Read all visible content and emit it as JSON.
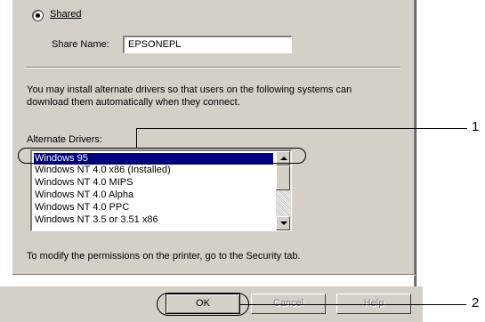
{
  "sharing": {
    "shared_label": "Shared",
    "shared_selected": true,
    "share_name_label": "Share Name:",
    "share_name_value": "EPSONEPL"
  },
  "drivers": {
    "description_line1": "You may install alternate drivers so that users on the following systems can",
    "description_line2": "download them automatically when they connect.",
    "list_label": "Alternate Drivers:",
    "items": [
      "Windows 95",
      "Windows NT 4.0 x86 (Installed)",
      "Windows NT 4.0 MIPS",
      "Windows NT 4.0 Alpha",
      "Windows NT 4.0 PPC",
      "Windows NT 3.5 or 3.51 x86"
    ],
    "selected_index": 0
  },
  "permissions_note": "To modify the permissions on the printer, go to the Security tab.",
  "buttons": {
    "ok": "OK",
    "cancel": "Cancel",
    "help": "Help"
  },
  "callouts": {
    "one": "1",
    "two": "2"
  }
}
